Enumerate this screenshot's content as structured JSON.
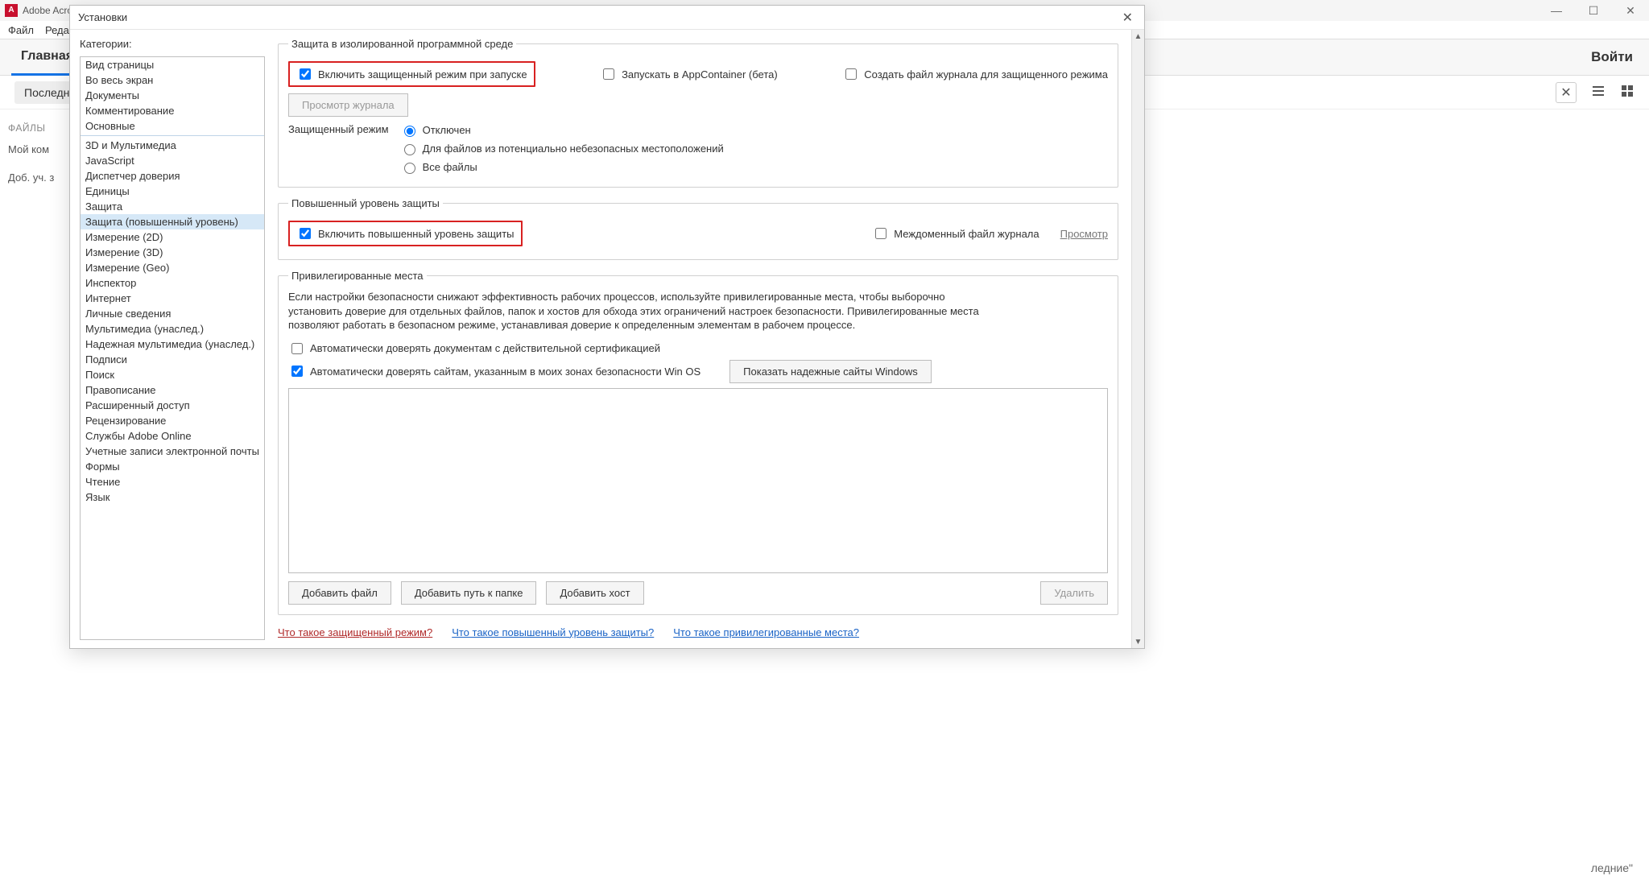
{
  "outer": {
    "app_title": "Adobe Acro",
    "menu": {
      "file": "Файл",
      "edit": "Редакти"
    },
    "main_tab": "Главная",
    "login": "Войти",
    "sub_pill": "Последни",
    "sidebar": {
      "files_hdr": "ФАЙЛЫ",
      "item_mycomp": "Мой ком",
      "item_add": "Доб. уч. з"
    },
    "bottom_right": "ледние\""
  },
  "dialog": {
    "title": "Установки",
    "categories_label": "Категории:",
    "categories_group1": [
      "Вид страницы",
      "Во весь экран",
      "Документы",
      "Комментирование",
      "Основные"
    ],
    "categories_group2": [
      "3D и Мультимедиа",
      "JavaScript",
      "Диспетчер доверия",
      "Единицы",
      "Защита",
      "Защита (повышенный уровень)",
      "Измерение (2D)",
      "Измерение (3D)",
      "Измерение (Geo)",
      "Инспектор",
      "Интернет",
      "Личные сведения",
      "Мультимедиа (унаслед.)",
      "Надежная мультимедиа (унаслед.)",
      "Подписи",
      "Поиск",
      "Правописание",
      "Расширенный доступ",
      "Рецензирование",
      "Службы Adobe Online",
      "Учетные записи электронной почты",
      "Формы",
      "Чтение",
      "Язык"
    ],
    "selected_category": "Защита (повышенный уровень)",
    "sec_sandbox": {
      "legend": "Защита в изолированной программной среде",
      "enable_protected": "Включить защищенный режим при запуске",
      "run_appcontainer": "Запускать в AppContainer (бета)",
      "create_logfile": "Создать файл журнала для защищенного режима",
      "view_log_btn": "Просмотр журнала",
      "mode_label": "Защищенный режим",
      "mode_off": "Отключен",
      "mode_unsafe": "Для файлов из потенциально небезопасных местоположений",
      "mode_all": "Все файлы"
    },
    "sec_enhanced": {
      "legend": "Повышенный уровень защиты",
      "enable_enhanced": "Включить повышенный уровень защиты",
      "crossdomain_log": "Междоменный файл журнала",
      "view_link": "Просмотр"
    },
    "sec_priv": {
      "legend": "Привилегированные места",
      "help": "Если настройки безопасности снижают эффективность рабочих процессов, используйте привилегированные места, чтобы выборочно установить доверие для отдельных файлов, папок и хостов для обхода этих ограничений настроек безопасности. Привилегированные места позволяют работать в безопасном режиме, устанавливая доверие к определенным элементам в рабочем процессе.",
      "auto_trust_cert": "Автоматически доверять документам с действительной сертификацией",
      "auto_trust_winos": "Автоматически доверять сайтам, указанным в моих зонах безопасности Win OS",
      "show_trusted_btn": "Показать надежные сайты Windows",
      "add_file": "Добавить файл",
      "add_folder": "Добавить путь к папке",
      "add_host": "Добавить хост",
      "delete": "Удалить"
    },
    "footer": {
      "link_protected": "Что такое защищенный режим?",
      "link_enhanced": "Что такое повышенный уровень защиты?",
      "link_priv": "Что такое привилегированные места?"
    }
  }
}
